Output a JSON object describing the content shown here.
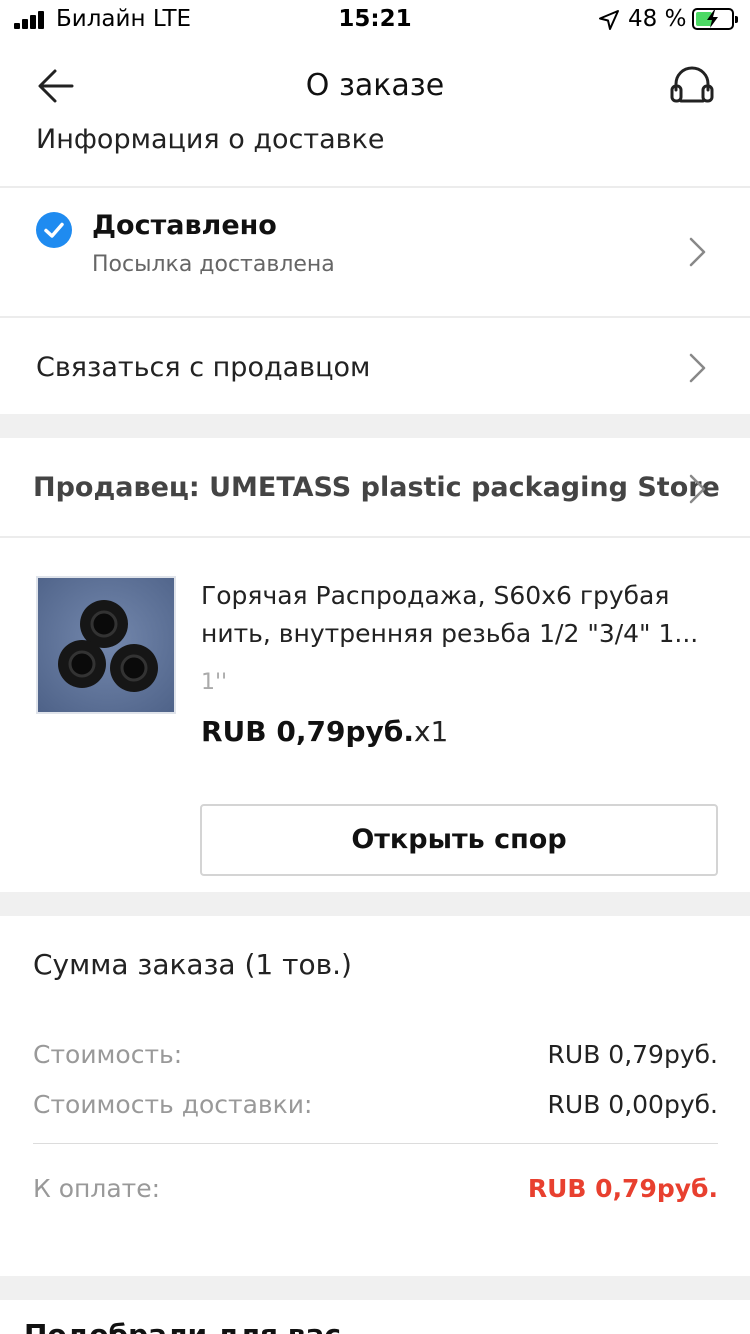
{
  "status_bar": {
    "carrier": "Билайн  LTE",
    "time": "15:21",
    "battery_percent": "48 %",
    "battery_level": 0.48
  },
  "nav": {
    "title": "О заказе"
  },
  "delivery": {
    "section_title": "Информация о доставке",
    "status_title": "Доставлено",
    "status_subtitle": "Посылка доставлена",
    "contact_seller": "Связаться с продавцом"
  },
  "seller": {
    "label": "Продавец: UMETASS plastic packaging Store"
  },
  "product": {
    "title_line1": "Горячая Распродажа, S60x6 грубая",
    "title_line2": "нить, внутренняя резьба 1/2 \"3/4\" 1...",
    "variant": "1''",
    "price": "RUB 0,79руб.",
    "quantity": "x1",
    "dispute_button": "Открыть спор"
  },
  "summary": {
    "title": "Сумма заказа (1 тов.)",
    "cost_label": "Стоимость:",
    "cost_value": "RUB 0,79руб.",
    "shipping_label": "Стоимость доставки:",
    "shipping_value": "RUB 0,00руб.",
    "total_label": "К оплате:",
    "total_value": "RUB 0,79руб."
  },
  "recommend": {
    "title": "Подобрали для вас"
  },
  "colors": {
    "accent_blue": "#1f8bf0",
    "total_red": "#e8402f",
    "battery_green": "#4cd964"
  }
}
